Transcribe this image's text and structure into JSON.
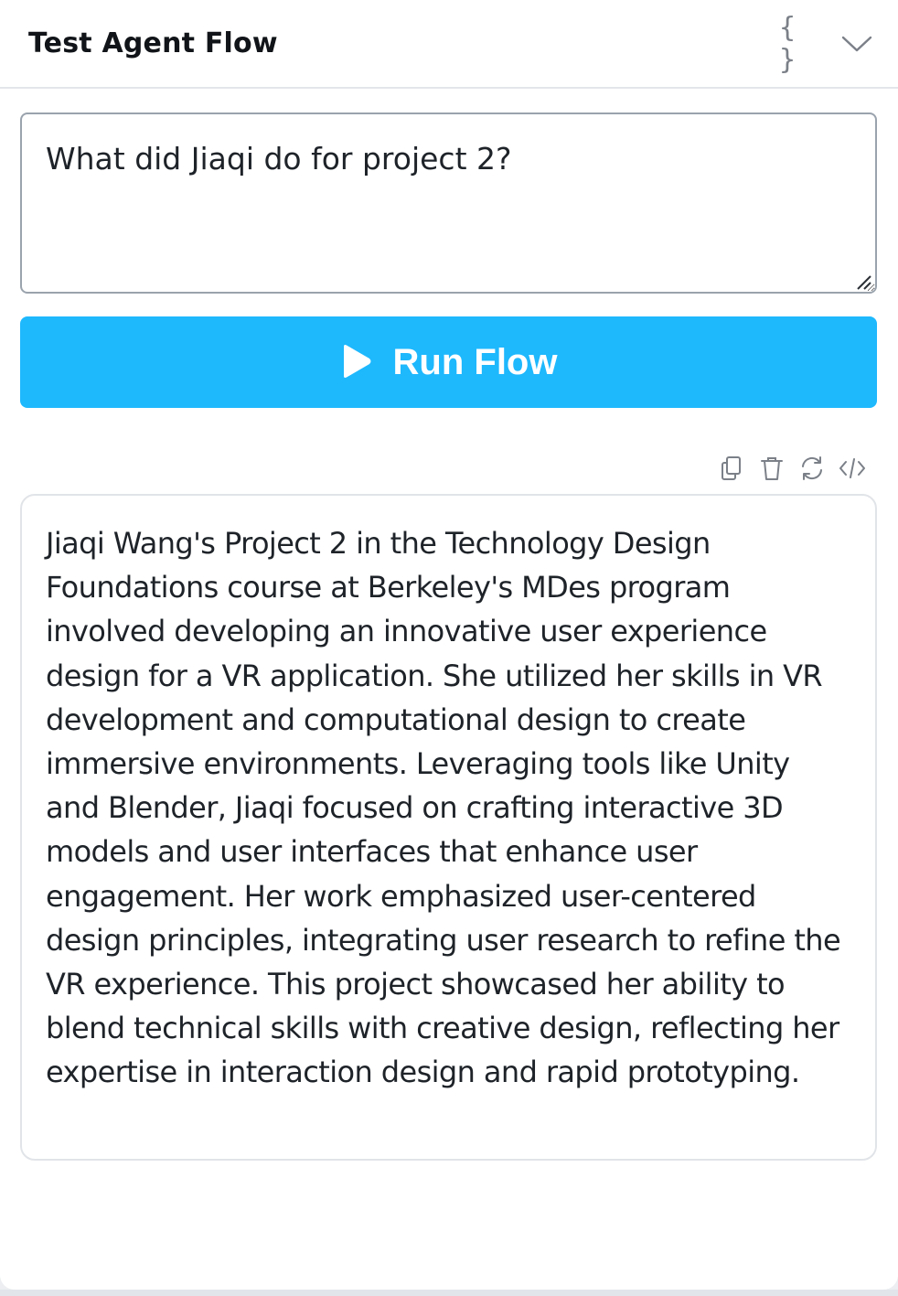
{
  "header": {
    "title": "Test Agent Flow",
    "json_icon": "braces-icon",
    "collapse_icon": "chevron-down-icon"
  },
  "prompt": {
    "value": "What did Jiaqi do for project 2?"
  },
  "run_button": {
    "label": "Run Flow",
    "icon": "play-icon",
    "color": "#1eb8fd"
  },
  "toolbar": {
    "icons": [
      "copy-icon",
      "trash-icon",
      "refresh-icon",
      "code-icon"
    ]
  },
  "response": {
    "text": "Jiaqi Wang's Project 2 in the Technology Design Foundations course at Berkeley's MDes program involved developing an innovative user experience design for a VR application. She utilized her skills in VR development and computational design to create immersive environments. Leveraging tools like Unity and Blender, Jiaqi focused on crafting interactive 3D models and user interfaces that enhance user engagement. Her work emphasized user-centered design principles, integrating user research to refine the VR experience. This project showcased her ability to blend technical skills with creative design, reflecting her expertise in interaction design and rapid prototyping."
  }
}
